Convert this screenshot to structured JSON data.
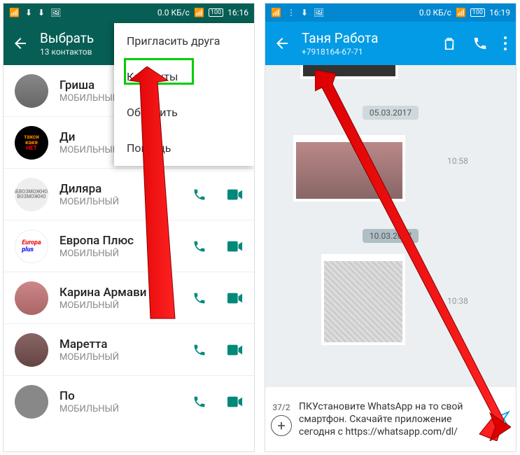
{
  "left": {
    "status": {
      "net": "0.0 КБ/с",
      "time": "16:16"
    },
    "header": {
      "title": "Выбрать",
      "sub": "13 контактов"
    },
    "menu": {
      "invite": "Пригласить друга",
      "contacts": "Контакты",
      "refresh": "Обновить",
      "help": "Помощь"
    },
    "contacts": [
      {
        "name": "Гриша",
        "sub": "МОБИЛЬНЫЙ"
      },
      {
        "name": "Ди",
        "sub": "МОБИЛЬНЫЙ"
      },
      {
        "name": "Диляра",
        "sub": "МОБИЛЬНЫЙ"
      },
      {
        "name": "Европа Плюс",
        "sub": "МОБИЛЬНЫЙ"
      },
      {
        "name": "Карина Армави",
        "sub": "МОБИЛЬНЫЙ"
      },
      {
        "name": "Маретта",
        "sub": "МОБИЛЬНЫЙ"
      },
      {
        "name": "По",
        "sub": "МОБИЛЬНЫЙ"
      }
    ]
  },
  "right": {
    "status": {
      "net": "0.0 КБ/с",
      "time": "16:19"
    },
    "header": {
      "title": "Таня Работа",
      "sub": "+7918164-67-71"
    },
    "dates": {
      "d1": "05.03.2017",
      "d2": "10.03.2017"
    },
    "times": {
      "t1": "10:58",
      "t2": "10:38"
    },
    "compose": {
      "count": "37/2",
      "text": "ПКУстановите WhatsApp на то свой смартфон. Скачайте приложение сегодня с https://whatsapp.com/dl/"
    }
  }
}
